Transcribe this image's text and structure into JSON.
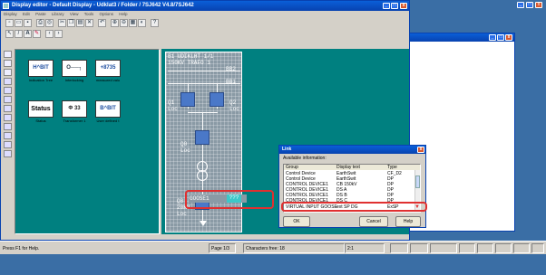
{
  "main_window": {
    "title": "Display editor - Default Display - UdkIat3 / Folder / 7SJ642 V4.8/7SJ642",
    "menu": [
      "Display",
      "Edit",
      "Paste",
      "Library",
      "View",
      "Tools",
      "Options",
      "Help"
    ]
  },
  "library": {
    "items": [
      {
        "icon_text": "H^BIT",
        "label": "Indication Tree"
      },
      {
        "icon_text": "O──┐",
        "label": "Interlocking"
      },
      {
        "icon_text": "+8735",
        "label": "measured valu"
      },
      {
        "icon_text": "Status",
        "label": "Status"
      },
      {
        "icon_text": "Φ 33",
        "label": "Transformer 1"
      },
      {
        "icon_text": "B^BIT",
        "label": "User defined t"
      }
    ]
  },
  "diagram": {
    "line1": "B1 UDIKLHT      1/1",
    "line2": "150KV TRAFO 1",
    "bus_right": "BB2",
    "bus_right2": "BB1",
    "q1": "Q1",
    "q2": "Q2",
    "loc": "Loc",
    "q0": "Q0",
    "goose": "GOOSE1",
    "goose_val": "???",
    "q8": "Q8",
    "kv": "20KV",
    "loc2": "Loc"
  },
  "dialog": {
    "title": "Link",
    "available_label": "Available information:",
    "columns": [
      "Group",
      "Display text",
      "Type"
    ],
    "rows": [
      [
        "Control Device",
        "EarthSwit",
        "CF_D2"
      ],
      [
        "Control Device",
        "EarthSwit",
        "DP"
      ],
      [
        "CONTROL DEVICE1",
        "CB 150kV",
        "DP"
      ],
      [
        "CONTROL DEVICE1",
        "DS A",
        "DP"
      ],
      [
        "CONTROL DEVICE1",
        "DS B",
        "DP"
      ],
      [
        "CONTROL DEVICE1",
        "DS C",
        "DP"
      ],
      [
        "VIRTUAL INPUT GOOSE",
        "ext SP DG",
        "ExSP"
      ]
    ],
    "ok_label": "OK",
    "cancel_label": "Cancel",
    "help_label": "Help"
  },
  "statusbar": {
    "help_text": "Press F1 for Help.",
    "page_text": "Page 1/3",
    "chars_text": "Characters free: 18",
    "ratio_text": "2:1"
  },
  "colors": {
    "desktop": "#3a6ea5",
    "teal": "#008080",
    "highlight": "#e03030"
  }
}
